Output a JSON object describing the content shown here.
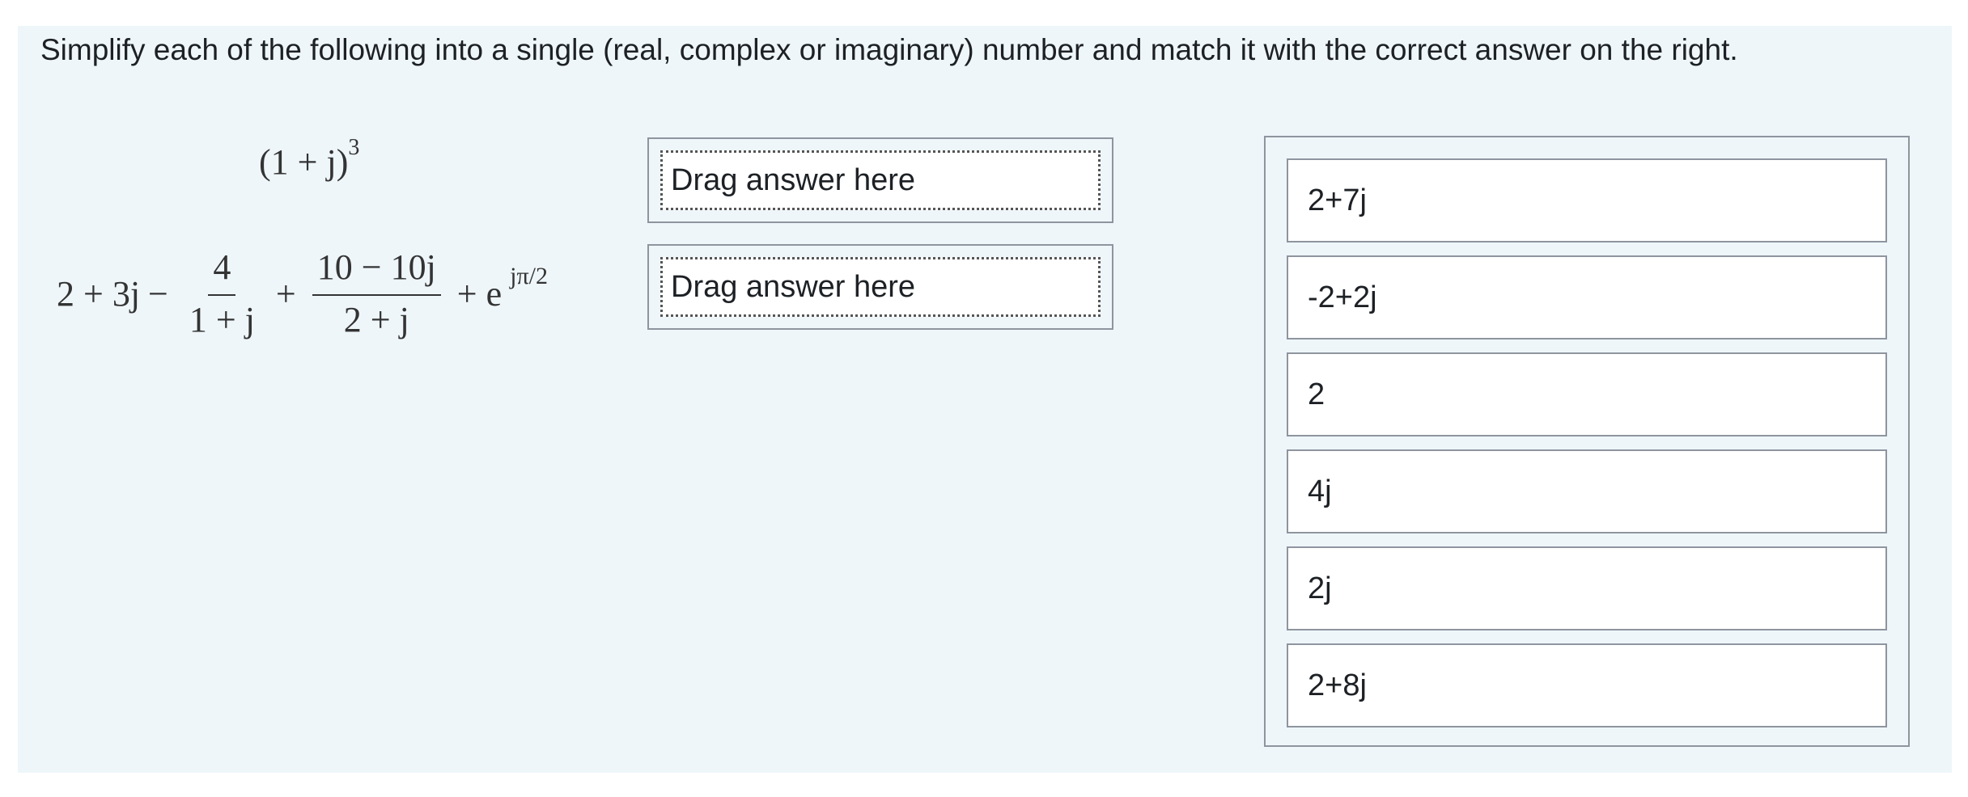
{
  "instruction": "Simplify each of the following into a single (real, complex or imaginary) number and match it with the correct answer on the right.",
  "questions": [
    {
      "expression_text": "(1 + j)^3",
      "parts": {
        "base": "(1 + j)",
        "exponent": "3"
      },
      "dropzone_label": "Drag answer here"
    },
    {
      "expression_text": "2 + 3j − 4/(1 + j) + (10 − 10j)/(2 + j) + e^(jπ/2)",
      "parts": {
        "lead": "2 + 3j",
        "minus": "−",
        "frac1_num": "4",
        "frac1_den": "1 + j",
        "plus": "+",
        "frac2_num": "10 − 10j",
        "frac2_den": "2 + j",
        "exp_base": "+ e",
        "exp_sup": "jπ/2"
      },
      "dropzone_label": "Drag answer here"
    }
  ],
  "answers": [
    "2+7j",
    "-2+2j",
    "2",
    "4j",
    "2j",
    "2+8j"
  ]
}
